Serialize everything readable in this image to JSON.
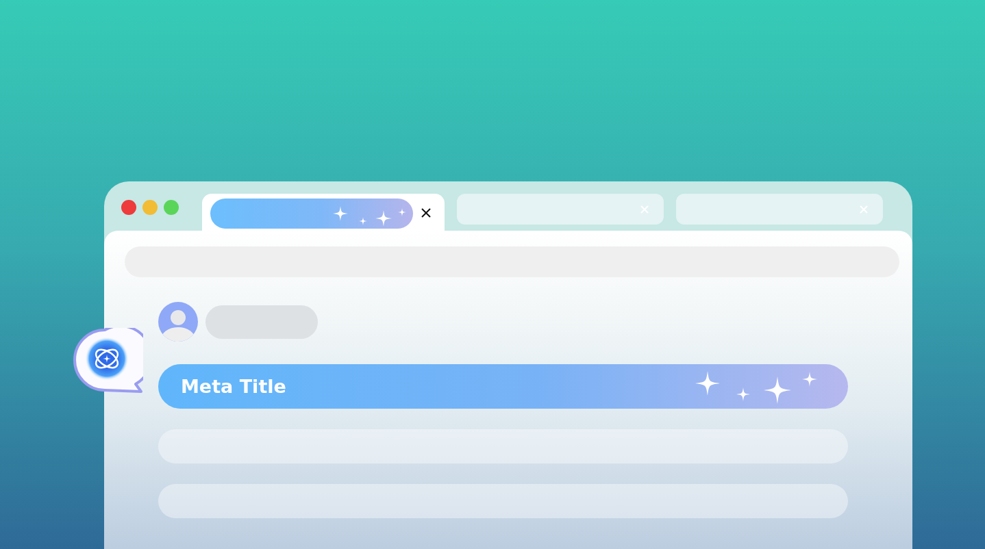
{
  "tabs": [
    {
      "selected": true
    },
    {
      "selected": false
    },
    {
      "selected": false
    }
  ],
  "highlighted_field": {
    "text": "Meta Title"
  }
}
